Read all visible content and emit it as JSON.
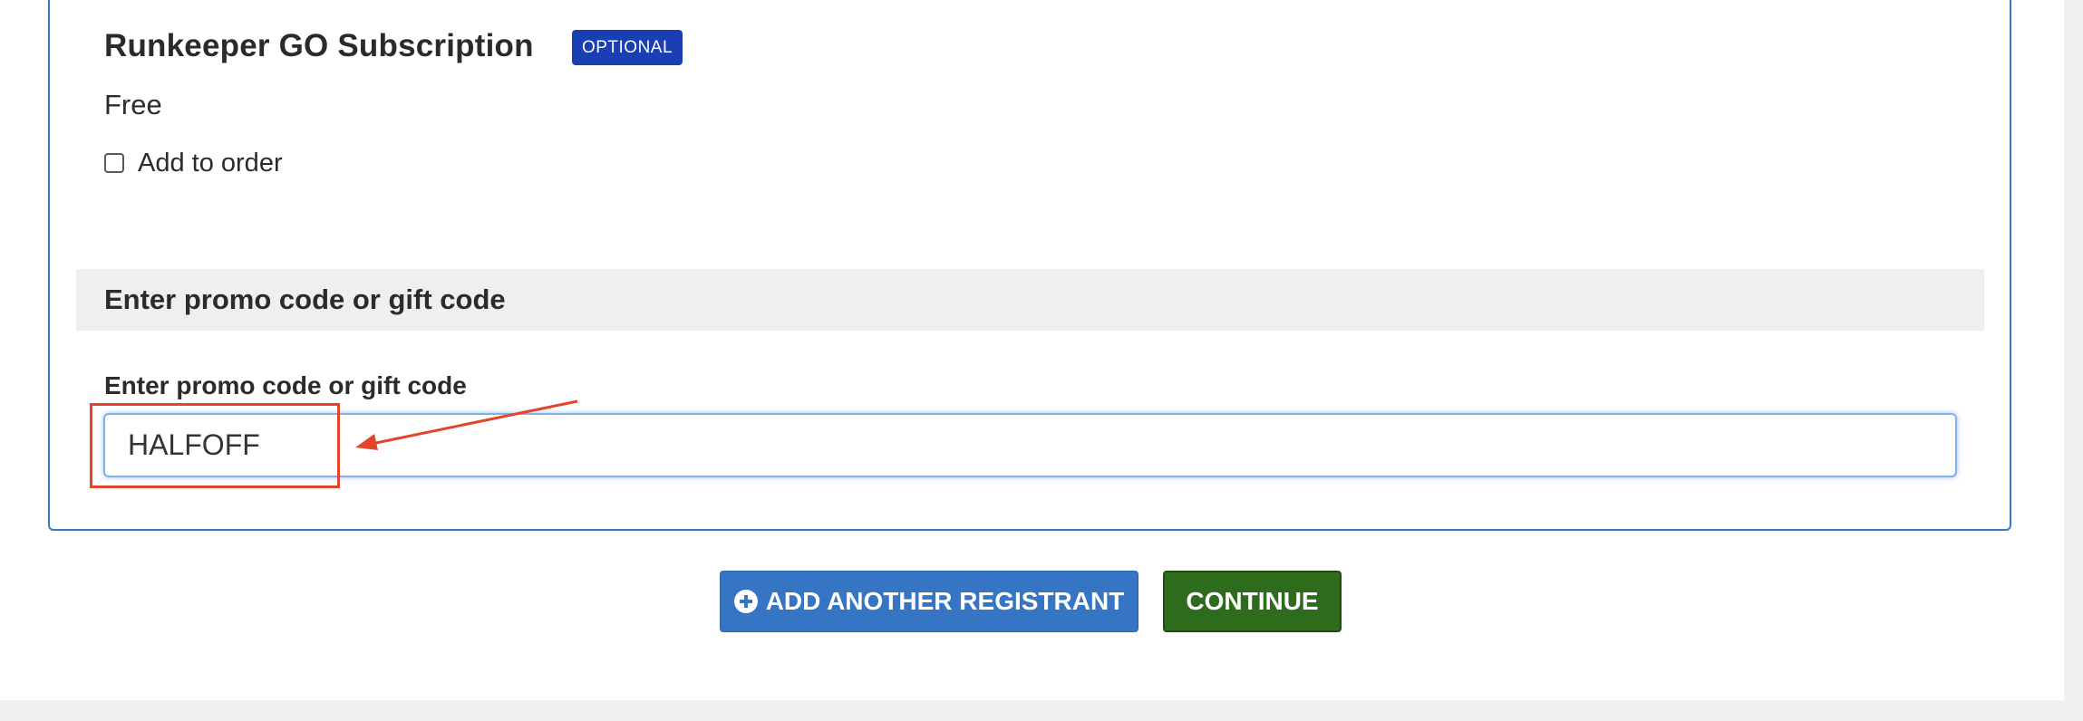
{
  "addon": {
    "title": "Runkeeper GO Subscription",
    "badge": "OPTIONAL",
    "price": "Free",
    "checkbox_label": "Add to order",
    "checked": false
  },
  "promo": {
    "section_title": "Enter promo code or gift code",
    "field_label": "Enter promo code or gift code",
    "value": "HALFOFF"
  },
  "buttons": {
    "add_registrant": "ADD ANOTHER REGISTRANT",
    "continue": "CONTINUE"
  },
  "annotation": {
    "color": "#e2452b"
  },
  "colors": {
    "card_border": "#3a78c3",
    "badge_bg": "#1a3fb5",
    "add_button_bg": "#3575c4",
    "continue_button_bg": "#2e6b1c",
    "page_bg": "#f0f0f0"
  }
}
